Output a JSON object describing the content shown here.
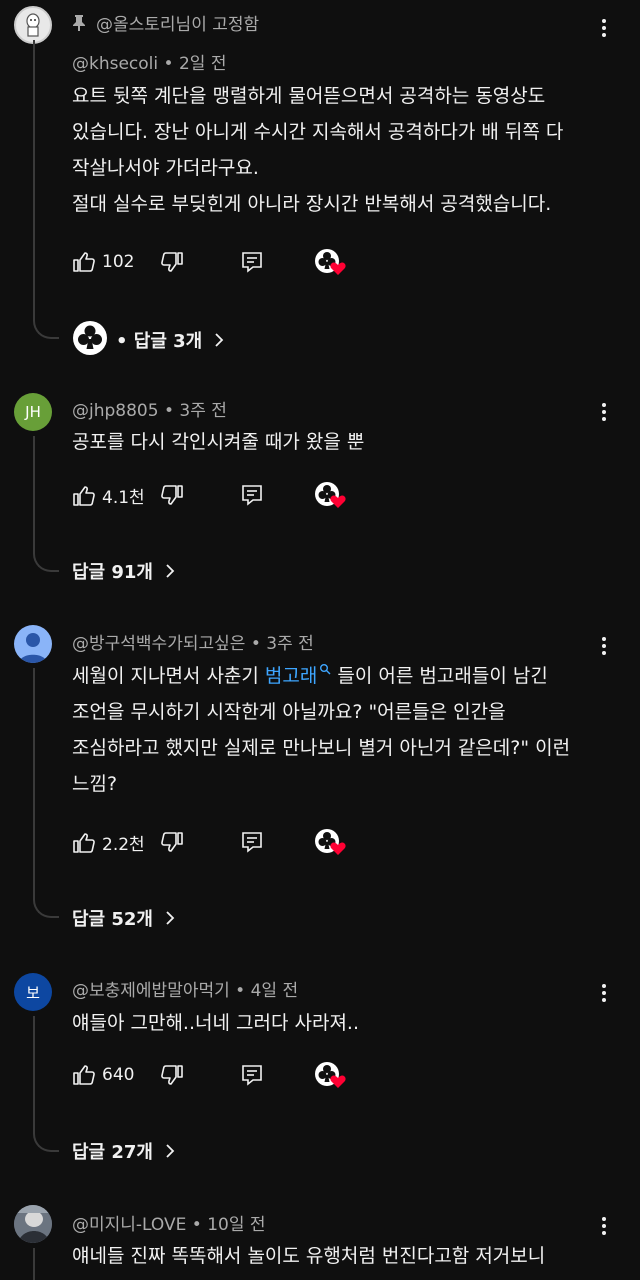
{
  "comments": [
    {
      "pinned_label": "@올스토리님이 고정함",
      "author": "@khsecoli",
      "time": "2일 전",
      "lines": [
        "요트 뒷쪽 계단을 맹렬하게 물어뜯으면서 공격하는 동영상도",
        "있습니다. 장난 아니게 수시간 지속해서 공격하다가 배 뒤쪽 다",
        "작살나서야 가더라구요.",
        "절대 실수로 부딪힌게 아니라 장시간 반복해서 공격했습니다."
      ],
      "likes": "102",
      "replies_label": "• 답글 3개"
    },
    {
      "avatar_text": "JH",
      "avatar_color": "#689f38",
      "author": "@jhp8805",
      "time": "3주 전",
      "lines": [
        "공포를 다시 각인시켜줄 때가 왔을 뿐"
      ],
      "likes": "4.1천",
      "replies_label": "답글 91개"
    },
    {
      "avatar_color": "#8ab4f8",
      "author": "@방구석백수가되고싶은",
      "time": "3주 전",
      "line1_before": "세월이 지나면서 사춘기 ",
      "line1_link": "범고래",
      "line1_after": " 들이 어른 범고래들이 남긴",
      "lines": [
        "조언을 무시하기 시작한게 아닐까요? \"어른들은 인간을",
        "조심하라고 했지만 실제로 만나보니 별거 아닌거 같은데?\" 이런",
        "느낌?"
      ],
      "likes": "2.2천",
      "replies_label": "답글 52개"
    },
    {
      "avatar_text": "보",
      "avatar_color": "#0d47a1",
      "author": "@보충제에밥말아먹기",
      "time": "4일 전",
      "lines": [
        "얘들아 그만해..너네 그러다 사라져.."
      ],
      "likes": "640",
      "replies_label": "답글 27개"
    },
    {
      "author": "@미지니-LOVE",
      "time": "10일 전",
      "lines": [
        "얘네들 진짜 똑똑해서 놀이도 유행처럼 번진다고함 저거보니"
      ]
    }
  ],
  "colors": {
    "background": "#0f0f0f",
    "link": "#3ea6ff",
    "heart": "#ff0033"
  }
}
